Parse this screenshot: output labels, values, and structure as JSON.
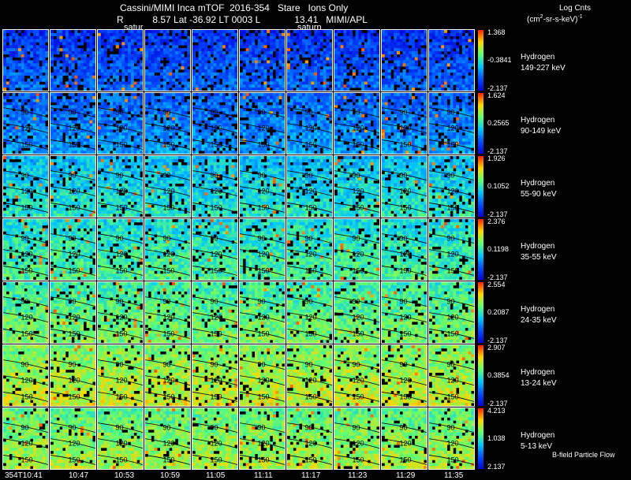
{
  "header": {
    "line1": "Cassini/MIMI Inca mTOF  2016-354   Stare   Ions Only",
    "line2": "R           8.57 Lat -36.92 LT 0003 L             13.41   MIMI/APL",
    "saturn_labels": [
      "satur",
      "saturn"
    ]
  },
  "colorbar_title": "Log Cnts",
  "colorbar_units_base": "(cm",
  "colorbar_units_sup": "2",
  "colorbar_units_rest": "-sr-s-keV)",
  "colorbar_units_tail": "-1",
  "footer_note": "B-field Particle Flow",
  "time_labels": [
    "354T10:41",
    "10:47",
    "10:53",
    "10:59",
    "11:05",
    "11:11",
    "11:17",
    "11:23",
    "11:29",
    "11:35"
  ],
  "pitch_labels": [
    "90",
    "120",
    "150"
  ],
  "colors": {
    "scale": [
      "#0000d8",
      "#0050ff",
      "#00c8ff",
      "#60ff70",
      "#ffd800",
      "#ff2000"
    ],
    "background": "#000000",
    "text": "#ffffff"
  },
  "chart_data": {
    "type": "heatmap",
    "title": "Cassini/MIMI Inca mTOF  2016-354   Stare   Ions Only",
    "x_time_ticks": [
      "354T10:41",
      "10:47",
      "10:53",
      "10:59",
      "11:05",
      "11:11",
      "11:17",
      "11:23",
      "11:29",
      "11:35"
    ],
    "panel_columns": 10,
    "panels": [
      {
        "species": "Hydrogen",
        "energy": "149-227 keV",
        "max": "1.368",
        "mid": "-0.3841",
        "min": "-2.137",
        "level": 0.12
      },
      {
        "species": "Hydrogen",
        "energy": "90-149 keV",
        "max": "1.624",
        "mid": "0.2565",
        "min": "-2.137",
        "level": 0.22
      },
      {
        "species": "Hydrogen",
        "energy": "55-90 keV",
        "max": "1.926",
        "mid": "0.1052",
        "min": "-2.137",
        "level": 0.38
      },
      {
        "species": "Hydrogen",
        "energy": "35-55 keV",
        "max": "2.376",
        "mid": "0.1198",
        "min": "-2.137",
        "level": 0.45
      },
      {
        "species": "Hydrogen",
        "energy": "24-35 keV",
        "max": "2.554",
        "mid": "0.2087",
        "min": "-2.137",
        "level": 0.52
      },
      {
        "species": "Hydrogen",
        "energy": "13-24 keV",
        "max": "2.907",
        "mid": "0.3854",
        "min": "-2.137",
        "level": 0.62
      },
      {
        "species": "Hydrogen",
        "energy": "5-13 keV",
        "max": "4.213",
        "mid": "1.038",
        "min": "2.137",
        "level": 0.58
      }
    ]
  }
}
